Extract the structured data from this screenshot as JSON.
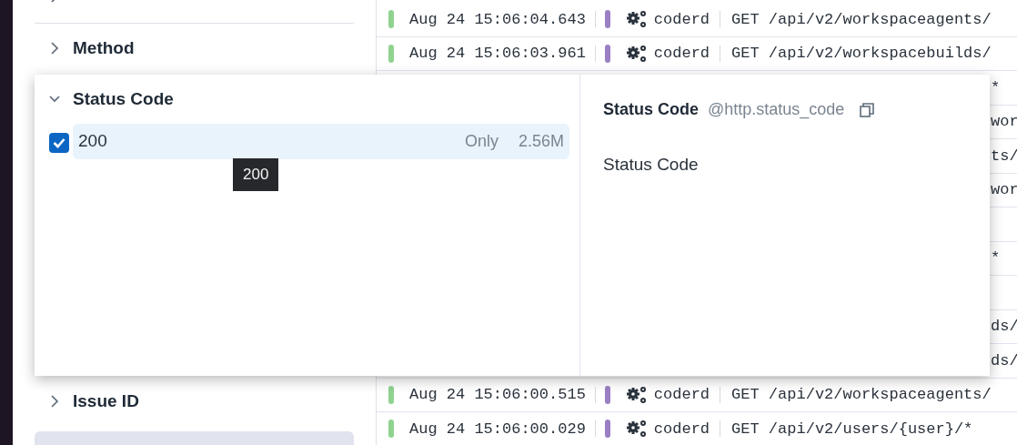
{
  "sidebar": {
    "facets": [
      {
        "expanded": false
      },
      {
        "label": "Method",
        "expanded": false
      },
      {
        "label": "Issue ID",
        "expanded": false
      }
    ]
  },
  "log_rows": [
    {
      "kind": "full",
      "date": "Aug 24 15:06:04.643",
      "service": "coderd",
      "message": "GET /api/v2/workspaceagents/"
    },
    {
      "kind": "full",
      "date": "Aug 24 15:06:03.961",
      "service": "coderd",
      "message": "GET /api/v2/workspacebuilds/"
    },
    {
      "kind": "covered",
      "tail": "*"
    },
    {
      "kind": "covered",
      "tail": "wor"
    },
    {
      "kind": "covered",
      "tail": "ts/"
    },
    {
      "kind": "covered",
      "tail": "wor"
    },
    {
      "kind": "covered"
    },
    {
      "kind": "covered",
      "tail": "*"
    },
    {
      "kind": "covered"
    },
    {
      "kind": "covered",
      "tail": "ds/"
    },
    {
      "kind": "covered",
      "tail": "ds/"
    },
    {
      "kind": "full",
      "date": "Aug 24 15:06:00.515",
      "service": "coderd",
      "message": "GET /api/v2/workspaceagents/"
    },
    {
      "kind": "full",
      "date": "Aug 24 15:06:00.029",
      "service": "coderd",
      "message": "GET /api/v2/users/{user}/*"
    }
  ],
  "popover": {
    "facet": {
      "label": "Status Code",
      "expanded": true
    },
    "values": [
      {
        "label": "200",
        "checked": true,
        "selected": true,
        "action": "Only",
        "count": "2.56M",
        "tooltip": "200"
      }
    ],
    "detail": {
      "title": "Status Code",
      "attribute": "@http.status_code",
      "description": "Status Code"
    }
  }
}
